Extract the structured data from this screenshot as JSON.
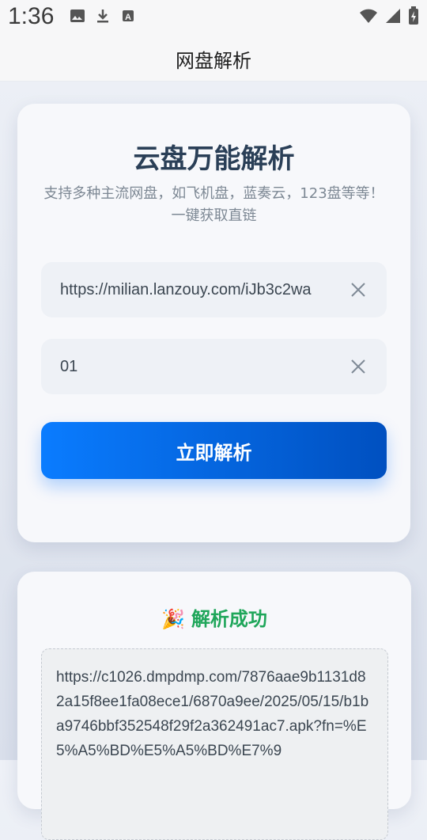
{
  "status": {
    "time": "1:36",
    "left_icons": [
      "image-icon",
      "download-icon",
      "a-box-icon"
    ],
    "right_icons": [
      "wifi-icon",
      "signal-icon",
      "battery-icon"
    ]
  },
  "appbar": {
    "title": "网盘解析"
  },
  "parser": {
    "title": "云盘万能解析",
    "subtitle": "支持多种主流网盘，如飞机盘，蓝奏云，123盘等等！一键获取直链",
    "url_value": "https://milian.lanzouy.com/iJb3c2wa",
    "code_value": "01",
    "submit_label": "立即解析"
  },
  "result": {
    "title": "解析成功",
    "link": "https://c1026.dmpdmp.com/7876aae9b1131d82a15f8ee1fa08ece1/6870a9ee/2025/05/15/b1ba9746bbf352548f29f2a362491ac7.apk?fn=%E5%A5%BD%E5%A5%BD%E7%9"
  },
  "colors": {
    "accent": "#0a7cff",
    "success": "#1fa65a",
    "title": "#2a3f57"
  }
}
